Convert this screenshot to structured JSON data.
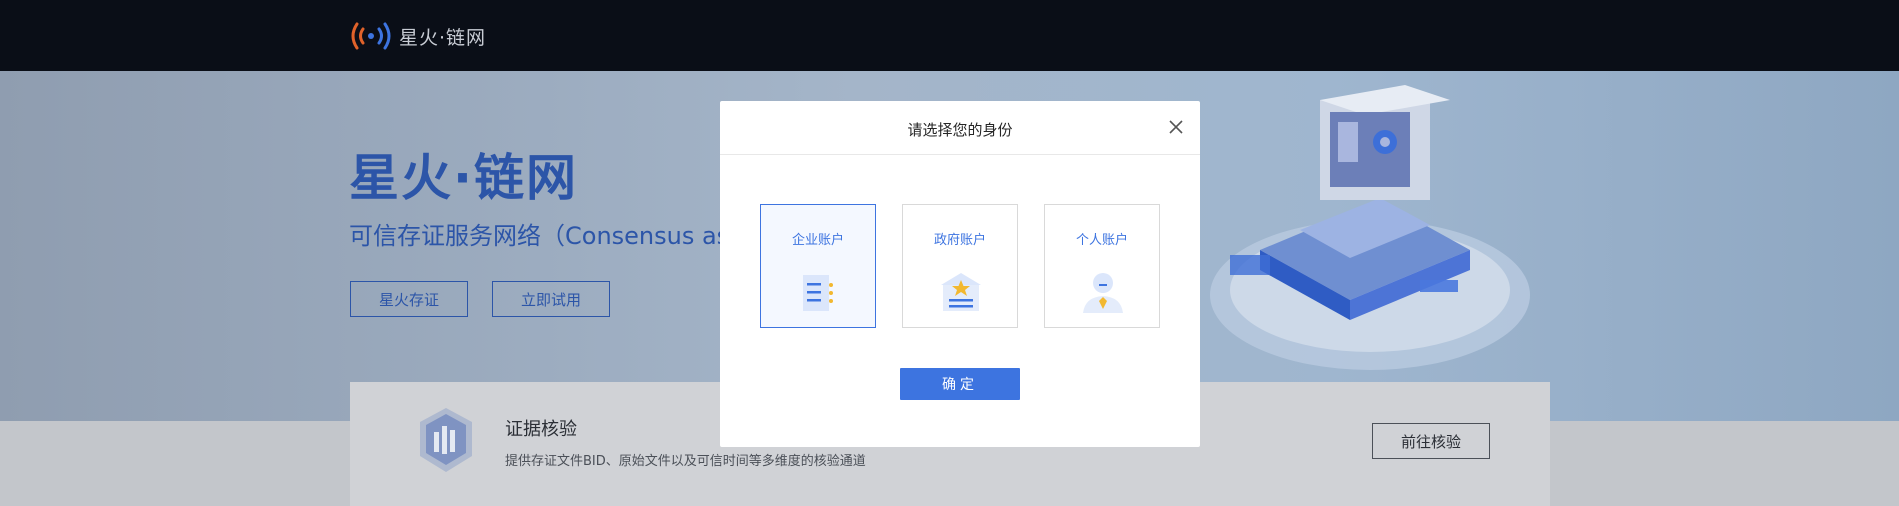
{
  "brand": {
    "name": "星火·链网"
  },
  "hero": {
    "title": "星火·链网",
    "subtitle": "可信存证服务网络（Consensus as",
    "buttons": [
      "星火存证",
      "立即试用"
    ]
  },
  "feature_card": {
    "title": "证据核验",
    "description": "提供存证文件BID、原始文件以及可信时间等多维度的核验通道",
    "button": "前往核验"
  },
  "dialog": {
    "title": "请选择您的身份",
    "options": [
      {
        "label": "企业账户",
        "icon": "enterprise-document-icon",
        "selected": true
      },
      {
        "label": "政府账户",
        "icon": "government-building-star-icon",
        "selected": false
      },
      {
        "label": "个人账户",
        "icon": "person-avatar-icon",
        "selected": false
      }
    ],
    "confirm_label": "确定"
  },
  "colors": {
    "accent": "#3d74e0",
    "nav_bg": "#0a0e17",
    "hero_text": "#2c55a8"
  }
}
